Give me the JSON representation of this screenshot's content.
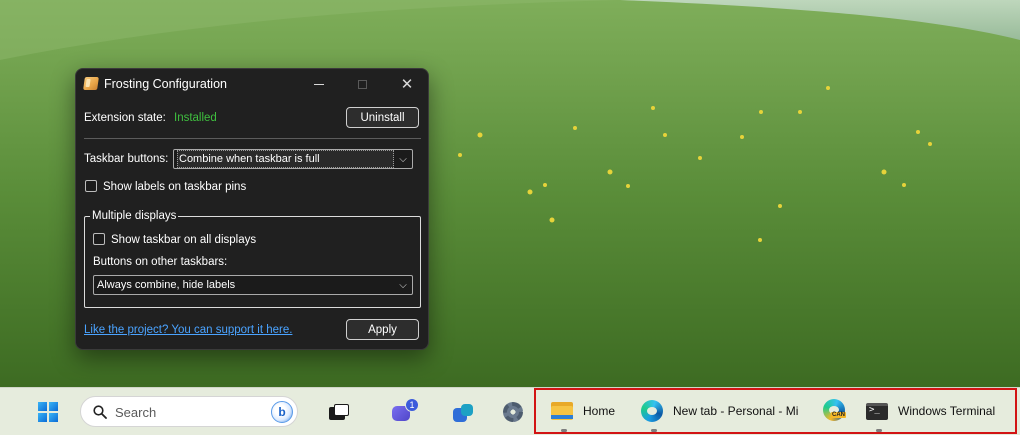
{
  "dialog": {
    "title": "Frosting Configuration",
    "extension_state_label": "Extension state:",
    "extension_state_value": "Installed",
    "uninstall_label": "Uninstall",
    "taskbar_buttons_label": "Taskbar buttons:",
    "taskbar_buttons_value": "Combine when taskbar is full",
    "show_labels_label": "Show labels on taskbar pins",
    "multiple_displays_legend": "Multiple displays",
    "show_all_displays_label": "Show taskbar on all displays",
    "other_taskbars_label": "Buttons on other taskbars:",
    "other_taskbars_value": "Always combine, hide labels",
    "support_link": "Like the project? You can support it here.",
    "apply_label": "Apply",
    "show_labels_checked": false,
    "show_all_displays_checked": false
  },
  "taskbar": {
    "search_placeholder": "Search",
    "chat_badge": "1",
    "apps": [
      {
        "label": "Home",
        "icon": "folder-icon"
      },
      {
        "label": "New tab - Personal - Mi",
        "icon": "edge-icon"
      },
      {
        "label": "",
        "icon": "edge-canary-icon"
      },
      {
        "label": "Windows Terminal",
        "icon": "terminal-icon"
      }
    ],
    "edge_canary_tag": "CAN"
  },
  "colors": {
    "accent_installed": "#3fbf3f",
    "link": "#4aa3ff",
    "highlight": "#d21414",
    "dialog_bg": "#202020",
    "taskbar_bg": "#e6ecdd"
  }
}
